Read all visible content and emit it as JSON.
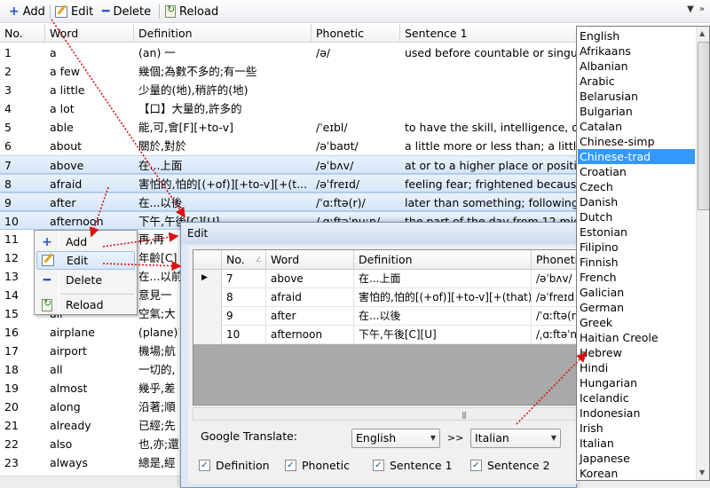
{
  "toolbar": {
    "add_label": "Add",
    "edit_label": "Edit",
    "delete_label": "Delete",
    "reload_label": "Reload"
  },
  "grid": {
    "headers": [
      "No.",
      "Word",
      "Definition",
      "Phonetic",
      "Sentence 1"
    ],
    "rows": [
      {
        "no": "1",
        "word": "a",
        "def": "(an) 一",
        "phon": "/ə/",
        "s1": "used before countable or singular"
      },
      {
        "no": "2",
        "word": "a few",
        "def": "幾個;為數不多的;有一些",
        "phon": "",
        "s1": ""
      },
      {
        "no": "3",
        "word": "a little",
        "def": "少量的(地),稍許的(地)",
        "phon": "",
        "s1": ""
      },
      {
        "no": "4",
        "word": "a lot",
        "def": "【口】大量的,許多的",
        "phon": "",
        "s1": ""
      },
      {
        "no": "5",
        "word": "able",
        "def": "能,可,會[F][+to-v]",
        "phon": "/ˈeɪbl/",
        "s1": "to have the skill, intelligence, opp"
      },
      {
        "no": "6",
        "word": "about",
        "def": "關於,對於",
        "phon": "/əˈbaʊt/",
        "s1": "a little more or less than; a little b"
      },
      {
        "no": "7",
        "word": "above",
        "def": "在...上面",
        "phon": "/əˈbʌv/",
        "s1": "at or to a higher place or positio"
      },
      {
        "no": "8",
        "word": "afraid",
        "def": "害怕的,怕的[(+of)][+to-v][+(t...",
        "phon": "/əˈfreɪd/",
        "s1": "feeling fear; frightened because y"
      },
      {
        "no": "9",
        "word": "after",
        "def": "在...以後",
        "phon": "/ˈɑːftə(r)/",
        "s1": "later than something; following sc"
      },
      {
        "no": "10",
        "word": "afternoon",
        "def": "下午,午後[C][U]",
        "phon": "/ˌɑːftəˈnuːn/",
        "s1": "the part of the day from 12 midd"
      },
      {
        "no": "11",
        "word": "",
        "def": "再,再",
        "phon": "",
        "s1": ""
      },
      {
        "no": "12",
        "word": "",
        "def": "年齡[C]",
        "phon": "",
        "s1": ""
      },
      {
        "no": "13",
        "word": "",
        "def": "在...以前",
        "phon": "",
        "s1": ""
      },
      {
        "no": "14",
        "word": "",
        "def": "意見一",
        "phon": "",
        "s1": ""
      },
      {
        "no": "15",
        "word": "air",
        "def": "空氣;大",
        "phon": "",
        "s1": ""
      },
      {
        "no": "16",
        "word": "airplane",
        "def": "(plane)",
        "phon": "",
        "s1": ""
      },
      {
        "no": "17",
        "word": "airport",
        "def": "機場;航",
        "phon": "",
        "s1": ""
      },
      {
        "no": "18",
        "word": "all",
        "def": "一切的,",
        "phon": "",
        "s1": ""
      },
      {
        "no": "19",
        "word": "almost",
        "def": "幾乎,差",
        "phon": "",
        "s1": ""
      },
      {
        "no": "20",
        "word": "along",
        "def": "沿著;順",
        "phon": "",
        "s1": ""
      },
      {
        "no": "21",
        "word": "already",
        "def": "已經;先",
        "phon": "",
        "s1": ""
      },
      {
        "no": "22",
        "word": "also",
        "def": "也,亦;還",
        "phon": "",
        "s1": ""
      },
      {
        "no": "23",
        "word": "always",
        "def": "總是,經",
        "phon": "",
        "s1": ""
      }
    ]
  },
  "context_menu": {
    "items": [
      "Add",
      "Edit",
      "Delete",
      "Reload"
    ]
  },
  "languages": {
    "items": [
      "English",
      "Afrikaans",
      "Albanian",
      "Arabic",
      "Belarusian",
      "Bulgarian",
      "Catalan",
      "Chinese-simp",
      "Chinese-trad",
      "Croatian",
      "Czech",
      "Danish",
      "Dutch",
      "Estonian",
      "Filipino",
      "Finnish",
      "French",
      "Galician",
      "German",
      "Greek",
      "Haitian Creole",
      "Hebrew",
      "Hindi",
      "Hungarian",
      "Icelandic",
      "Indonesian",
      "Irish",
      "Italian",
      "Japanese",
      "Korean"
    ],
    "selected_index": 8
  },
  "edit_dialog": {
    "title": "Edit",
    "headers": [
      "No.",
      "Word",
      "Definition",
      "Phoneti"
    ],
    "rows": [
      {
        "no": "7",
        "word": "above",
        "def": "在...上面",
        "phon": "/əˈbʌv/"
      },
      {
        "no": "8",
        "word": "afraid",
        "def": "害怕的,怕的[(+of)][+to-v][+(that)]",
        "phon": "/əˈfreɪd"
      },
      {
        "no": "9",
        "word": "after",
        "def": "在...以後",
        "phon": "/ˈɑːftə(r"
      },
      {
        "no": "10",
        "word": "afternoon",
        "def": "下午,午後[C][U]",
        "phon": "/ˌɑːftəˈn"
      }
    ],
    "google_translate_label": "Google Translate:",
    "from_language": "English",
    "arrow_label": ">>",
    "to_language": "Italian",
    "checkboxes": [
      {
        "label": "Definition",
        "checked": true
      },
      {
        "label": "Phonetic",
        "checked": true
      },
      {
        "label": "Sentence 1",
        "checked": true
      },
      {
        "label": "Sentence 2",
        "checked": true
      }
    ]
  },
  "colors": {
    "selection": "#3399ff",
    "row_highlight": "#d4e6f8",
    "annotation_arrow": "#dd1111"
  }
}
